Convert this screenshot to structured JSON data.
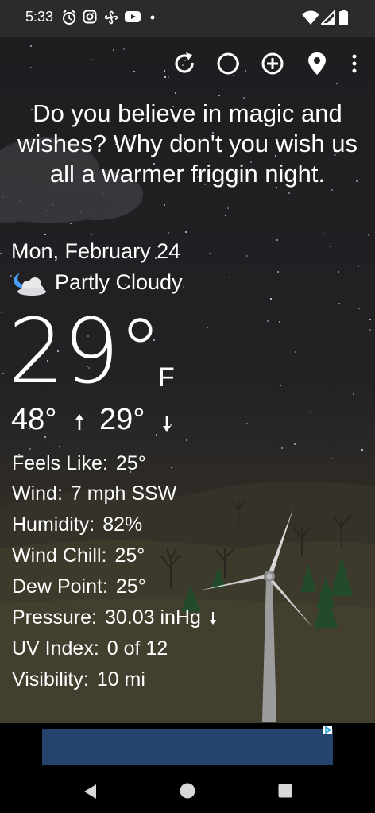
{
  "status_bar": {
    "time": "5:33",
    "icons": [
      "alarm-icon",
      "instagram-icon",
      "fan-icon",
      "youtube-icon",
      "dot-icon",
      "wifi-icon",
      "signal-icon",
      "battery-icon"
    ]
  },
  "toolbar": {
    "icons": [
      "refresh-icon",
      "theme-icon",
      "add-location-icon",
      "location-pin-icon",
      "overflow-menu-icon"
    ]
  },
  "quote": "Do you believe in magic and wishes? Why don't you wish us all a warmer friggin night.",
  "weather": {
    "date": "Mon, February 24",
    "condition": "Partly Cloudy",
    "condition_icon": "partly-cloudy-night-icon",
    "temperature": "29°",
    "unit": "F",
    "high": "48°",
    "low": "29°"
  },
  "details": [
    {
      "label": "Feels Like:",
      "value": "25°"
    },
    {
      "label": "Wind:",
      "value": "7 mph SSW"
    },
    {
      "label": "Humidity:",
      "value": "82%"
    },
    {
      "label": "Wind Chill:",
      "value": "25°"
    },
    {
      "label": "Dew Point:",
      "value": "25°"
    },
    {
      "label": "Pressure:",
      "value": "30.03 inHg"
    },
    {
      "label": "UV Index:",
      "value": "0 of 12"
    },
    {
      "label": "Visibility:",
      "value": "10 mi"
    }
  ],
  "nav": {
    "icons": [
      "back-icon",
      "home-icon",
      "recents-icon"
    ]
  },
  "colors": {
    "background": "#1b1b1d",
    "status_bar": "#2b2b2d",
    "ad_banner": "#25436c",
    "text": "#ffffff"
  }
}
